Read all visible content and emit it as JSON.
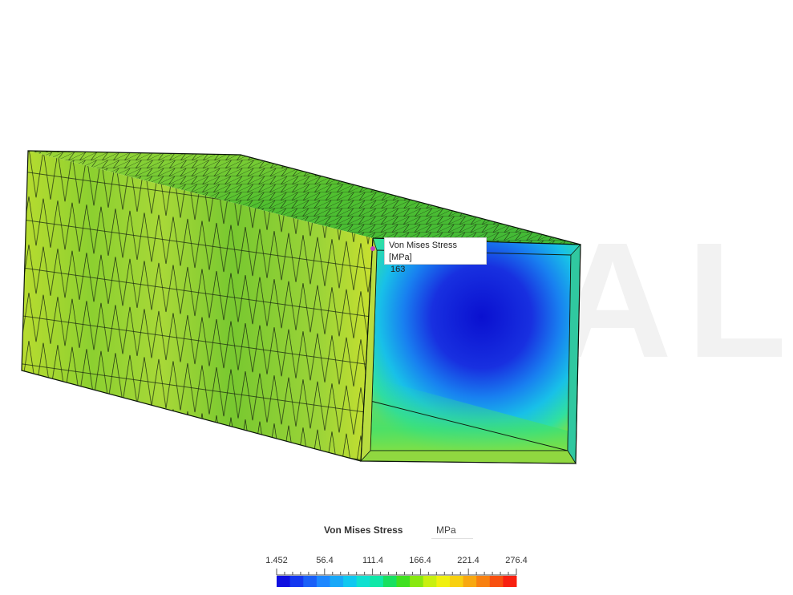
{
  "watermark": {
    "text": "ALE"
  },
  "probe": {
    "label": "Von Mises Stress [MPa]",
    "value": "163",
    "marker_color": "#c040c0"
  },
  "legend": {
    "title": "Von Mises Stress",
    "unit": "MPa",
    "ticks": [
      "1.452",
      "56.4",
      "111.4",
      "166.4",
      "221.4",
      "276.4"
    ],
    "min": 1.452,
    "max": 276.4,
    "colors": [
      "#1010e0",
      "#1438f0",
      "#1a60f8",
      "#1e88ff",
      "#18a8f8",
      "#10c8f0",
      "#10e0d0",
      "#10e8a8",
      "#18e060",
      "#40e020",
      "#88e810",
      "#c8f010",
      "#f0f010",
      "#f8d010",
      "#f8a810",
      "#f88010",
      "#f85010",
      "#f82010"
    ]
  }
}
